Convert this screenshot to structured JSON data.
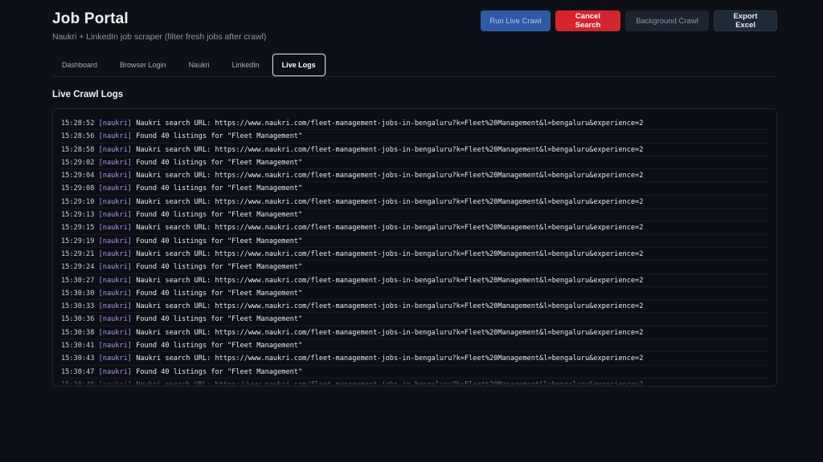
{
  "header": {
    "title": "Job Portal",
    "subtitle": "Naukri + LinkedIn job scraper (filter fresh jobs after crawl)"
  },
  "actions": {
    "run_live_crawl": "Run Live Crawl",
    "cancel_search": "Cancel Search",
    "background_crawl": "Background Crawl",
    "export_excel": "Export Excel"
  },
  "tabs": [
    {
      "label": "Dashboard"
    },
    {
      "label": "Browser Login"
    },
    {
      "label": "Naukri"
    },
    {
      "label": "LinkedIn"
    },
    {
      "label": "Live Logs",
      "active": true
    }
  ],
  "logs": {
    "title": "Live Crawl Logs",
    "lines": [
      {
        "time": "15:28:52",
        "tag": "[naukri]",
        "msg": "Naukri search URL: https://www.naukri.com/fleet-management-jobs-in-bengaluru?k=Fleet%20Management&l=bengaluru&experience=2"
      },
      {
        "time": "15:28:56",
        "tag": "[naukri]",
        "msg": "Found 40 listings for \"Fleet Management\""
      },
      {
        "time": "15:28:58",
        "tag": "[naukri]",
        "msg": "Naukri search URL: https://www.naukri.com/fleet-management-jobs-in-bengaluru?k=Fleet%20Management&l=bengaluru&experience=2"
      },
      {
        "time": "15:29:02",
        "tag": "[naukri]",
        "msg": "Found 40 listings for \"Fleet Management\""
      },
      {
        "time": "15:29:04",
        "tag": "[naukri]",
        "msg": "Naukri search URL: https://www.naukri.com/fleet-management-jobs-in-bengaluru?k=Fleet%20Management&l=bengaluru&experience=2"
      },
      {
        "time": "15:29:08",
        "tag": "[naukri]",
        "msg": "Found 40 listings for \"Fleet Management\""
      },
      {
        "time": "15:29:10",
        "tag": "[naukri]",
        "msg": "Naukri search URL: https://www.naukri.com/fleet-management-jobs-in-bengaluru?k=Fleet%20Management&l=bengaluru&experience=2"
      },
      {
        "time": "15:29:13",
        "tag": "[naukri]",
        "msg": "Found 40 listings for \"Fleet Management\""
      },
      {
        "time": "15:29:15",
        "tag": "[naukri]",
        "msg": "Naukri search URL: https://www.naukri.com/fleet-management-jobs-in-bengaluru?k=Fleet%20Management&l=bengaluru&experience=2"
      },
      {
        "time": "15:29:19",
        "tag": "[naukri]",
        "msg": "Found 40 listings for \"Fleet Management\""
      },
      {
        "time": "15:29:21",
        "tag": "[naukri]",
        "msg": "Naukri search URL: https://www.naukri.com/fleet-management-jobs-in-bengaluru?k=Fleet%20Management&l=bengaluru&experience=2"
      },
      {
        "time": "15:29:24",
        "tag": "[naukri]",
        "msg": "Found 40 listings for \"Fleet Management\""
      },
      {
        "time": "15:30:27",
        "tag": "[naukri]",
        "msg": "Naukri search URL: https://www.naukri.com/fleet-management-jobs-in-bengaluru?k=Fleet%20Management&l=bengaluru&experience=2"
      },
      {
        "time": "15:30:30",
        "tag": "[naukri]",
        "msg": "Found 40 listings for \"Fleet Management\""
      },
      {
        "time": "15:30:33",
        "tag": "[naukri]",
        "msg": "Naukri search URL: https://www.naukri.com/fleet-management-jobs-in-bengaluru?k=Fleet%20Management&l=bengaluru&experience=2"
      },
      {
        "time": "15:30:36",
        "tag": "[naukri]",
        "msg": "Found 40 listings for \"Fleet Management\""
      },
      {
        "time": "15:30:38",
        "tag": "[naukri]",
        "msg": "Naukri search URL: https://www.naukri.com/fleet-management-jobs-in-bengaluru?k=Fleet%20Management&l=bengaluru&experience=2"
      },
      {
        "time": "15:30:41",
        "tag": "[naukri]",
        "msg": "Found 40 listings for \"Fleet Management\""
      },
      {
        "time": "15:30:43",
        "tag": "[naukri]",
        "msg": "Naukri search URL: https://www.naukri.com/fleet-management-jobs-in-bengaluru?k=Fleet%20Management&l=bengaluru&experience=2"
      },
      {
        "time": "15:30:47",
        "tag": "[naukri]",
        "msg": "Found 40 listings for \"Fleet Management\""
      },
      {
        "time": "15:30:49",
        "tag": "[naukri]",
        "msg": "Naukri search URL: https://www.naukri.com/fleet-management-jobs-in-bengaluru?k=Fleet%20Management&l=bengaluru&experience=2"
      }
    ]
  },
  "colors": {
    "background": "#0d1117",
    "primary": "#2f5aa8",
    "danger": "#d6242c",
    "log_tag": "#b392f0"
  }
}
